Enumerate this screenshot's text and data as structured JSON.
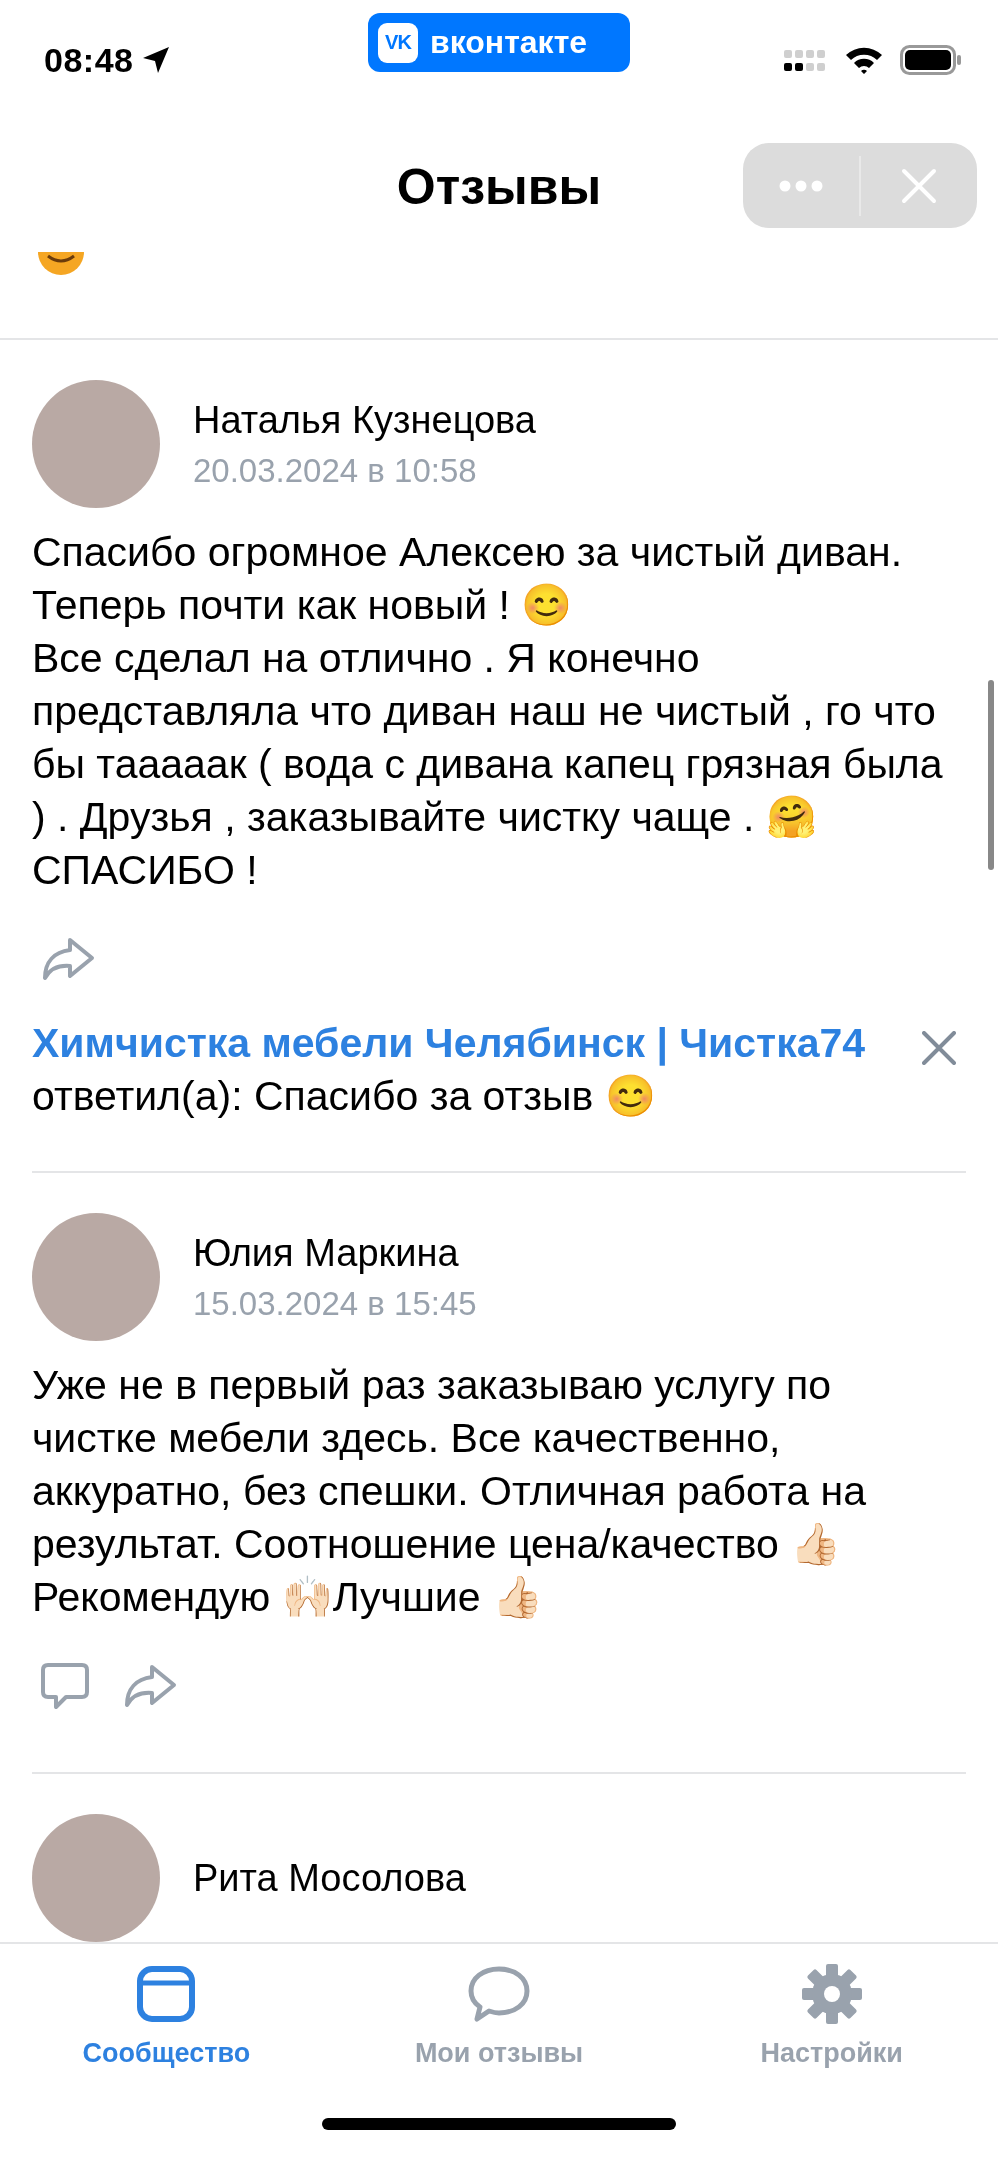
{
  "status_bar": {
    "time": "08:48",
    "app_badge": {
      "logo": "VK",
      "label": "вконтакте"
    }
  },
  "header": {
    "title": "Отзывы"
  },
  "reviews": [
    {
      "author": "Наталья Кузнецова",
      "date": "20.03.2024 в 10:58",
      "text": "Спасибо огромное Алексею за чистый диван. Теперь почти как новый ! 😊\nВсе сделал на отлично . Я конечно представляла что диван наш не чистый , го что бы тааааак ( вода с дивана капец грязная была ) . Друзья , заказывайте чистку чаще . 🤗 СПАСИБО !",
      "actions": [
        {
          "kind": "share"
        }
      ],
      "reply": {
        "author": "Химчистка мебели Челябинск | Чистка74",
        "text": "ответил(а): Спасибо за отзыв 😊"
      }
    },
    {
      "author": "Юлия Маркина",
      "date": "15.03.2024 в 15:45",
      "text": "Уже не в первый раз заказываю услугу по чистке мебели здесь. Все качественно, аккуратно, без спешки. Отличная работа на результат. Соотношение цена/качество 👍🏻 Рекомендую 🙌🏻Лучшие 👍🏻",
      "actions": [
        {
          "kind": "comment"
        },
        {
          "kind": "share"
        }
      ]
    },
    {
      "author": "Рита Мосолова"
    }
  ],
  "tab_bar": {
    "tabs": [
      {
        "label": "Сообщество",
        "kind": "community",
        "selected": true
      },
      {
        "label": "Мои отзывы",
        "kind": "reviews",
        "selected": false
      },
      {
        "label": "Настройки",
        "kind": "settings",
        "selected": false
      }
    ]
  }
}
